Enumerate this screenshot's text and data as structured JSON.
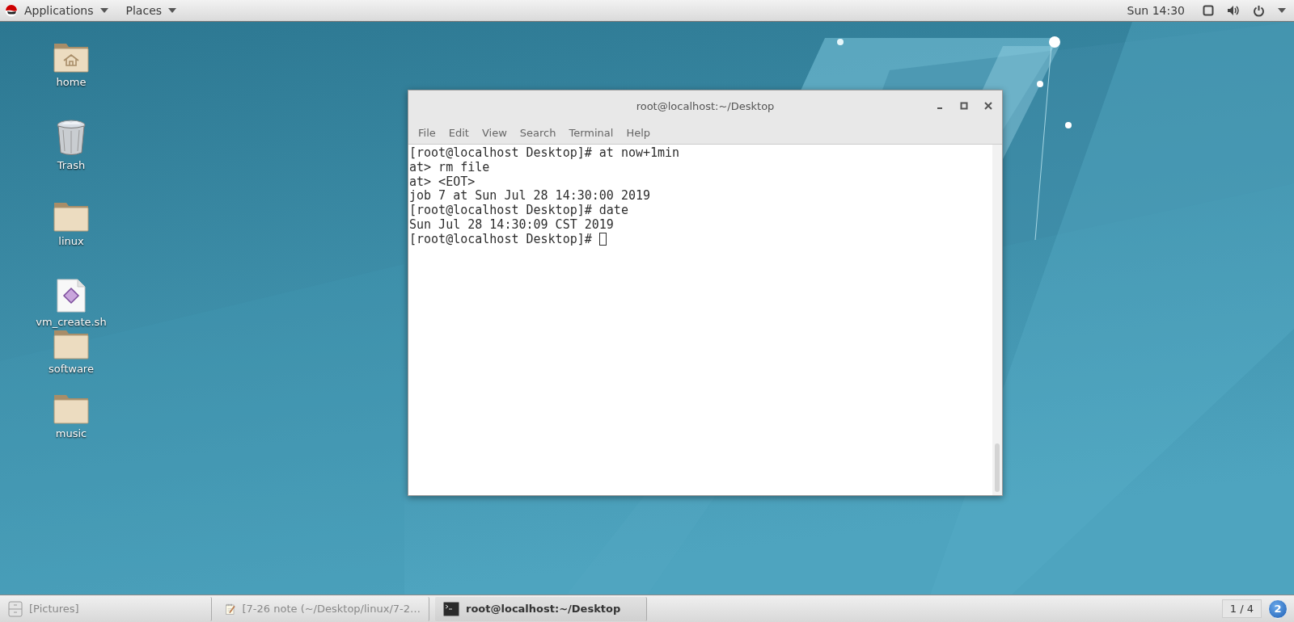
{
  "top_bar": {
    "menus": [
      {
        "label": "Applications"
      },
      {
        "label": "Places"
      }
    ],
    "clock": "Sun 14:30"
  },
  "desktop_icons": [
    {
      "label": "home",
      "kind": "home-folder"
    },
    {
      "label": "Trash",
      "kind": "trash"
    },
    {
      "label": "linux",
      "kind": "folder"
    },
    {
      "label": "vm_create.sh",
      "kind": "script"
    },
    {
      "label": "software",
      "kind": "folder"
    },
    {
      "label": "music",
      "kind": "folder"
    }
  ],
  "terminal": {
    "title": "root@localhost:~/Desktop",
    "menus": [
      "File",
      "Edit",
      "View",
      "Search",
      "Terminal",
      "Help"
    ],
    "lines": [
      "[root@localhost Desktop]# at now+1min",
      "at> rm file",
      "at> <EOT>",
      "job 7 at Sun Jul 28 14:30:00 2019",
      "[root@localhost Desktop]# date",
      "Sun Jul 28 14:30:09 CST 2019",
      "[root@localhost Desktop]# "
    ],
    "cursor": true
  },
  "taskbar": {
    "items": [
      {
        "label": "[Pictures]",
        "kind": "files",
        "selected": false
      },
      {
        "label": "[7-26 note (~/Desktop/linux/7-2…",
        "kind": "editor",
        "selected": false
      },
      {
        "label": "root@localhost:~/Desktop",
        "kind": "terminal",
        "selected": true
      }
    ],
    "workspace": "1 / 4",
    "notification_count": "2"
  }
}
